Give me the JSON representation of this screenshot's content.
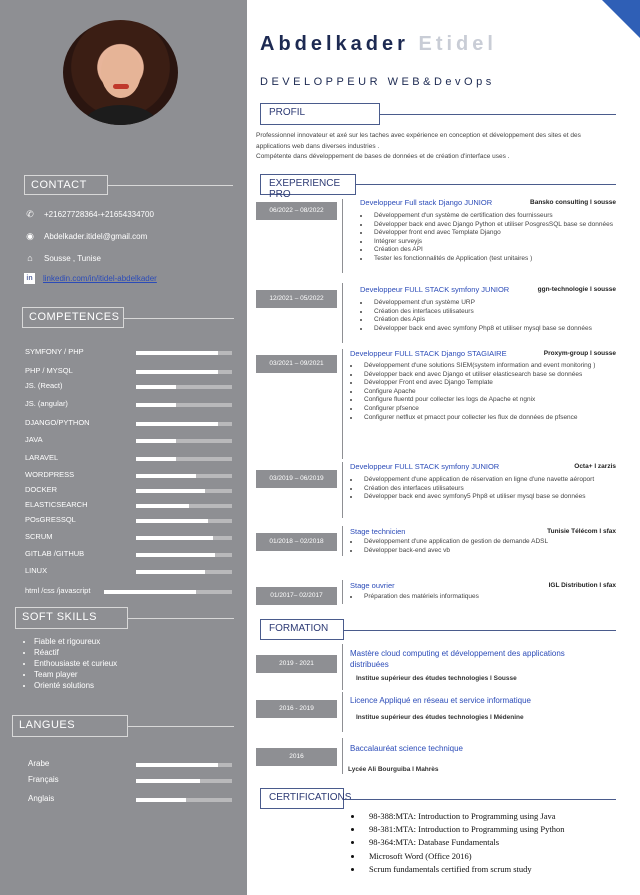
{
  "name": {
    "first": "Abdelkader",
    "last": "Etidel"
  },
  "job_title": "DEVELOPPEUR WEB&DevOps",
  "sidebar": {
    "contact_heading": "CONTACT",
    "phone": "+21627728364-+21654334700",
    "email": "Abdelkader.itidel@gmail.com",
    "location": "Sousse , Tunise",
    "linkedin_badge": "in",
    "linkedin": "linkedin.com/in/itidel-abdelkader",
    "competences_heading": "COMPETENCES",
    "skills": [
      {
        "label": "SYMFONY / PHP",
        "level": 0.85
      },
      {
        "label": "PHP / MYSQL",
        "level": 0.85
      },
      {
        "label": "JS. (React)",
        "level": 0.42
      },
      {
        "label": "JS. (angular)",
        "level": 0.42
      },
      {
        "label": "DJANGO/PYTHON",
        "level": 0.85
      },
      {
        "label": "JAVA",
        "level": 0.42
      },
      {
        "label": "LARAVEL",
        "level": 0.42
      },
      {
        "label": "WORDPRESS",
        "level": 0.62
      },
      {
        "label": "DOCKER",
        "level": 0.72
      },
      {
        "label": "ELASTICSEARCH",
        "level": 0.55
      },
      {
        "label": "POsGRESSQL",
        "level": 0.75
      },
      {
        "label": "SCRUM",
        "level": 0.8
      },
      {
        "label": "GITLAB /GITHUB",
        "level": 0.82
      },
      {
        "label": "LINUX",
        "level": 0.72
      },
      {
        "label": "html /css /javascript",
        "level": 0.72
      }
    ],
    "soft_heading": "SOFT SKILLS",
    "soft_skills": [
      "Fiable et rigoureux",
      "Réactif",
      "Enthousiaste et curieux",
      "Team player",
      "Orienté solutions"
    ],
    "langues_heading": "LANGUES",
    "languages": [
      {
        "label": "Arabe",
        "level": 0.85
      },
      {
        "label": "Français",
        "level": 0.67
      },
      {
        "label": "Anglais",
        "level": 0.52
      }
    ]
  },
  "profil": {
    "heading": "PROFIL",
    "text1": "Professionnel innovateur et axé sur les  taches avec expérience en conception et développement des sites et des applications web dans diverses industries .",
    "text2": "Compétente dans développement  de bases de données et de création d'interface uses ."
  },
  "experience": {
    "heading": "EXEPERIENCE PRO",
    "jobs": [
      {
        "date": "06/2022 – 08/2022",
        "title": "Developpeur  Full stack Django JUNIOR",
        "company": "Bansko consulting  l  sousse",
        "tasks": [
          "Développement d'un système de certification des fournisseurs",
          "Développer back end avec Django Python et utiliser PosgresSQL base se données",
          "Développer front end avec Template Django",
          "Intégrer surveyjs",
          "Création des API",
          "Tester les fonctionnalités de Application (test unitaires )"
        ]
      },
      {
        "date": "12/2021 – 05/2022",
        "title": "Developpeur  FULL STACK symfony JUNIOR",
        "company": "ggn-technologie l  sousse",
        "tasks": [
          "Développement  d'un système URP",
          "Création des interfaces utilisateurs",
          "Création des Apis",
          "Développer back end avec symfony Php8 et utiliser mysql base se données"
        ]
      },
      {
        "date": "03/2021 – 09/2021",
        "title": "Developpeur  FULL STACK Django STAGIAIRE",
        "company": "Proxym-group l  sousse",
        "tasks": [
          "Développement d'une solutions SIEM(system information and event monitoring )",
          "Développer back end avec Django  et utiliser elasticsearch  base se données",
          "Développer Front end avec Django Template",
          "Configure Apache",
          "Configure fluentd pour collecter les logs de Apache et ngnix",
          "Configurer pfsence",
          "Configurer  netflux et pmacct pour collecter les flux de données de pfsence"
        ]
      },
      {
        "date": "03/2019 – 06/2019",
        "title": "Developpeur  FULL STACK symfony JUNIOR",
        "company": "Octa+ l  zarzis",
        "tasks": [
          "Développement   d'une application de réservation en ligne d'une navette aéroport",
          "Création des interfaces utilisateurs",
          "Développer back end avec symfony5 Php8 et utiliser mysql base se données"
        ]
      },
      {
        "date": "01/2018 – 02/2018",
        "title": "Stage technicien",
        "company": "Tunisie Télécom l  sfax",
        "tasks": [
          "Développement d'une application de gestion de demande ADSL",
          "Développer back-end avec vb"
        ]
      },
      {
        "date": "01/2017– 02/2017",
        "title": "Stage ouvrier",
        "company": "IGL Distribution  l  sfax",
        "tasks": [
          "Préparation des matériels informatiques"
        ]
      }
    ]
  },
  "formation": {
    "heading": "FORMATION",
    "items": [
      {
        "date": "2019 - 2021",
        "degree": "Mastère cloud computing et développement des applications distribuées",
        "school": "Institue supérieur des études technologies   l Sousse"
      },
      {
        "date": "2016 - 2019",
        "degree": "Licence Appliqué en réseau et service informatique",
        "school": "Institue supérieur des études technologies   l Médenine"
      },
      {
        "date": "2016",
        "degree": "Baccalauréat science technique",
        "school": "Lycée Ali Bourguiba  l  Mahrès"
      }
    ]
  },
  "certifications": {
    "heading": "CERTIFICATIONS",
    "items": [
      "98-388:MTA: Introduction to Programming using Java",
      "98-381:MTA: Introduction to Programming using Python",
      " 98-364:MTA: Database Fundamentals",
      "Microsoft Word (Office 2016)",
      "Scrum fundamentals certified from scrum study"
    ]
  }
}
